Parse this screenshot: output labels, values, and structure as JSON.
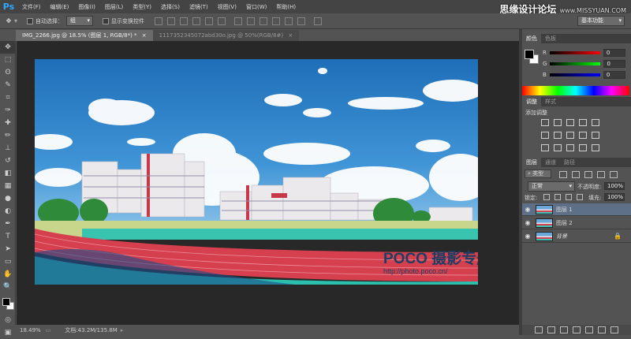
{
  "app": {
    "logo": "Ps"
  },
  "menu": [
    "文件(F)",
    "编辑(E)",
    "图像(I)",
    "图层(L)",
    "类型(Y)",
    "选择(S)",
    "滤镜(T)",
    "视图(V)",
    "窗口(W)",
    "帮助(H)"
  ],
  "window_controls": {
    "minimize": "—",
    "maximize": "□",
    "close": "✕"
  },
  "watermark": {
    "text": "思缘设计论坛",
    "url": "www.MISSYUAN.COM"
  },
  "options": {
    "auto_select_label": "自动选择：",
    "auto_select_value": "组",
    "show_transform_label": "显示变换控件",
    "workspace": "基本功能"
  },
  "tabs": [
    {
      "label": "IMG_2266.jpg @ 18.5% (图层 1, RGB/8*) *",
      "close": "×",
      "active": true
    },
    {
      "label": "1117352345072abd30o.jpg @ 50%(RGB/8#)",
      "close": "×",
      "active": false
    }
  ],
  "tools": [
    "move-tool",
    "marquee-tool",
    "lasso-tool",
    "quick-select-tool",
    "crop-tool",
    "eyedropper-tool",
    "healing-tool",
    "brush-tool",
    "clone-stamp-tool",
    "history-brush-tool",
    "eraser-tool",
    "gradient-tool",
    "blur-tool",
    "dodge-tool",
    "pen-tool",
    "type-tool",
    "path-select-tool",
    "shape-tool",
    "hand-tool",
    "zoom-tool"
  ],
  "tool_glyphs": [
    "✥",
    "⬚",
    "ʘ",
    "✎",
    "⌗",
    "✑",
    "✚",
    "✏",
    "⊥",
    "↺",
    "◧",
    "▦",
    "●",
    "◐",
    "✒",
    "T",
    "➤",
    "▭",
    "✋",
    "🔍"
  ],
  "artwork": {
    "logo": "POCO 摄影专题",
    "url": "http://photo.poco.cn/"
  },
  "status": {
    "zoom": "18.49%",
    "doc": "文档:43.2M/135.8M"
  },
  "color_panel": {
    "tabs": [
      "颜色",
      "色板"
    ],
    "channels": [
      {
        "label": "R",
        "value": "0"
      },
      {
        "label": "G",
        "value": "0"
      },
      {
        "label": "B",
        "value": "0"
      }
    ]
  },
  "adjust_panel": {
    "tabs": [
      "调整",
      "样式"
    ],
    "title": "添加调整"
  },
  "layers_panel": {
    "tabs": [
      "图层",
      "通道",
      "路径"
    ],
    "filter": "类型",
    "blend_mode": "正常",
    "opacity_label": "不透明度:",
    "opacity": "100%",
    "lock_label": "锁定:",
    "fill_label": "填充:",
    "fill": "100%",
    "layers": [
      {
        "name": "图层 1",
        "selected": true
      },
      {
        "name": "图层 2",
        "selected": false
      },
      {
        "name": "背景",
        "selected": false,
        "locked": true
      }
    ]
  },
  "colors": {
    "accent": "#31a8ff",
    "track": "#d8424c",
    "field": "#2cc0ae",
    "sky": "#2f7fc4"
  }
}
